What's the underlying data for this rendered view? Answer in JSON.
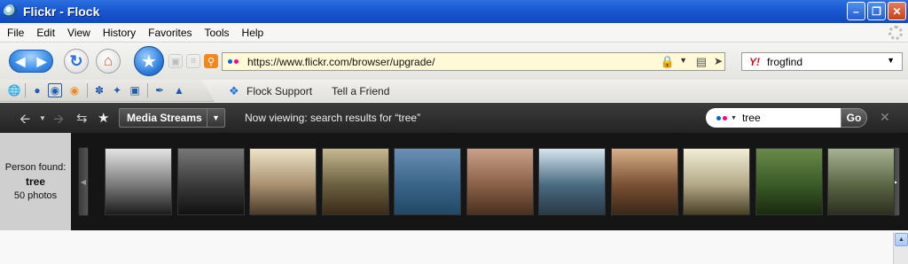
{
  "window": {
    "title": "Flickr - Flock"
  },
  "menu": [
    "File",
    "Edit",
    "View",
    "History",
    "Favorites",
    "Tools",
    "Help"
  ],
  "nav": {
    "url": "https://www.flickr.com/browser/upgrade/",
    "search_engine": "yahoo",
    "search_value": "frogfind"
  },
  "bookmarks": [
    "Flock Support",
    "Tell a Friend"
  ],
  "media_bar": {
    "streams_label": "Media Streams",
    "viewing_text": "Now viewing: search results for “tree”",
    "search_value": "tree",
    "go_label": "Go"
  },
  "person": {
    "found_label": "Person found:",
    "name": "tree",
    "count": "50 photos"
  },
  "thumbnails": [
    {
      "name": "misty-forest-bw",
      "colors": [
        "#e4e4e4",
        "#7a7a7a",
        "#1c1c1c"
      ]
    },
    {
      "name": "dark-forest",
      "colors": [
        "#777",
        "#3a3a3a",
        "#111"
      ]
    },
    {
      "name": "rackham-illustration",
      "colors": [
        "#efe4c8",
        "#a89070",
        "#4a3a28"
      ]
    },
    {
      "name": "fairy-tale-painting",
      "colors": [
        "#c8b890",
        "#6a6040",
        "#3a2a1a"
      ]
    },
    {
      "name": "kayak-on-water",
      "colors": [
        "#6a90b6",
        "#3a6488",
        "#224866"
      ]
    },
    {
      "name": "autumn-woods",
      "colors": [
        "#caa088",
        "#8a6048",
        "#4a3020"
      ]
    },
    {
      "name": "ferry-harbor",
      "colors": [
        "#d6e4ee",
        "#4a6a80",
        "#2a3a46"
      ]
    },
    {
      "name": "forest-path",
      "colors": [
        "#d8b088",
        "#7a5034",
        "#3a2818"
      ]
    },
    {
      "name": "lone-tree-sepia",
      "colors": [
        "#f2eed6",
        "#b2a886",
        "#4a4026"
      ]
    },
    {
      "name": "green-lane",
      "colors": [
        "#6a8a4a",
        "#3a5a28",
        "#1a2a10"
      ]
    },
    {
      "name": "woodland-trees",
      "colors": [
        "#a6b292",
        "#5a6644",
        "#2c3020"
      ]
    }
  ],
  "colors": {
    "titlebar": "#1a57d0",
    "url_bg": "#fff9d8",
    "media_bar": "#2a2a2a",
    "flickr_blue": "#0063dc",
    "flickr_pink": "#ff0084"
  }
}
